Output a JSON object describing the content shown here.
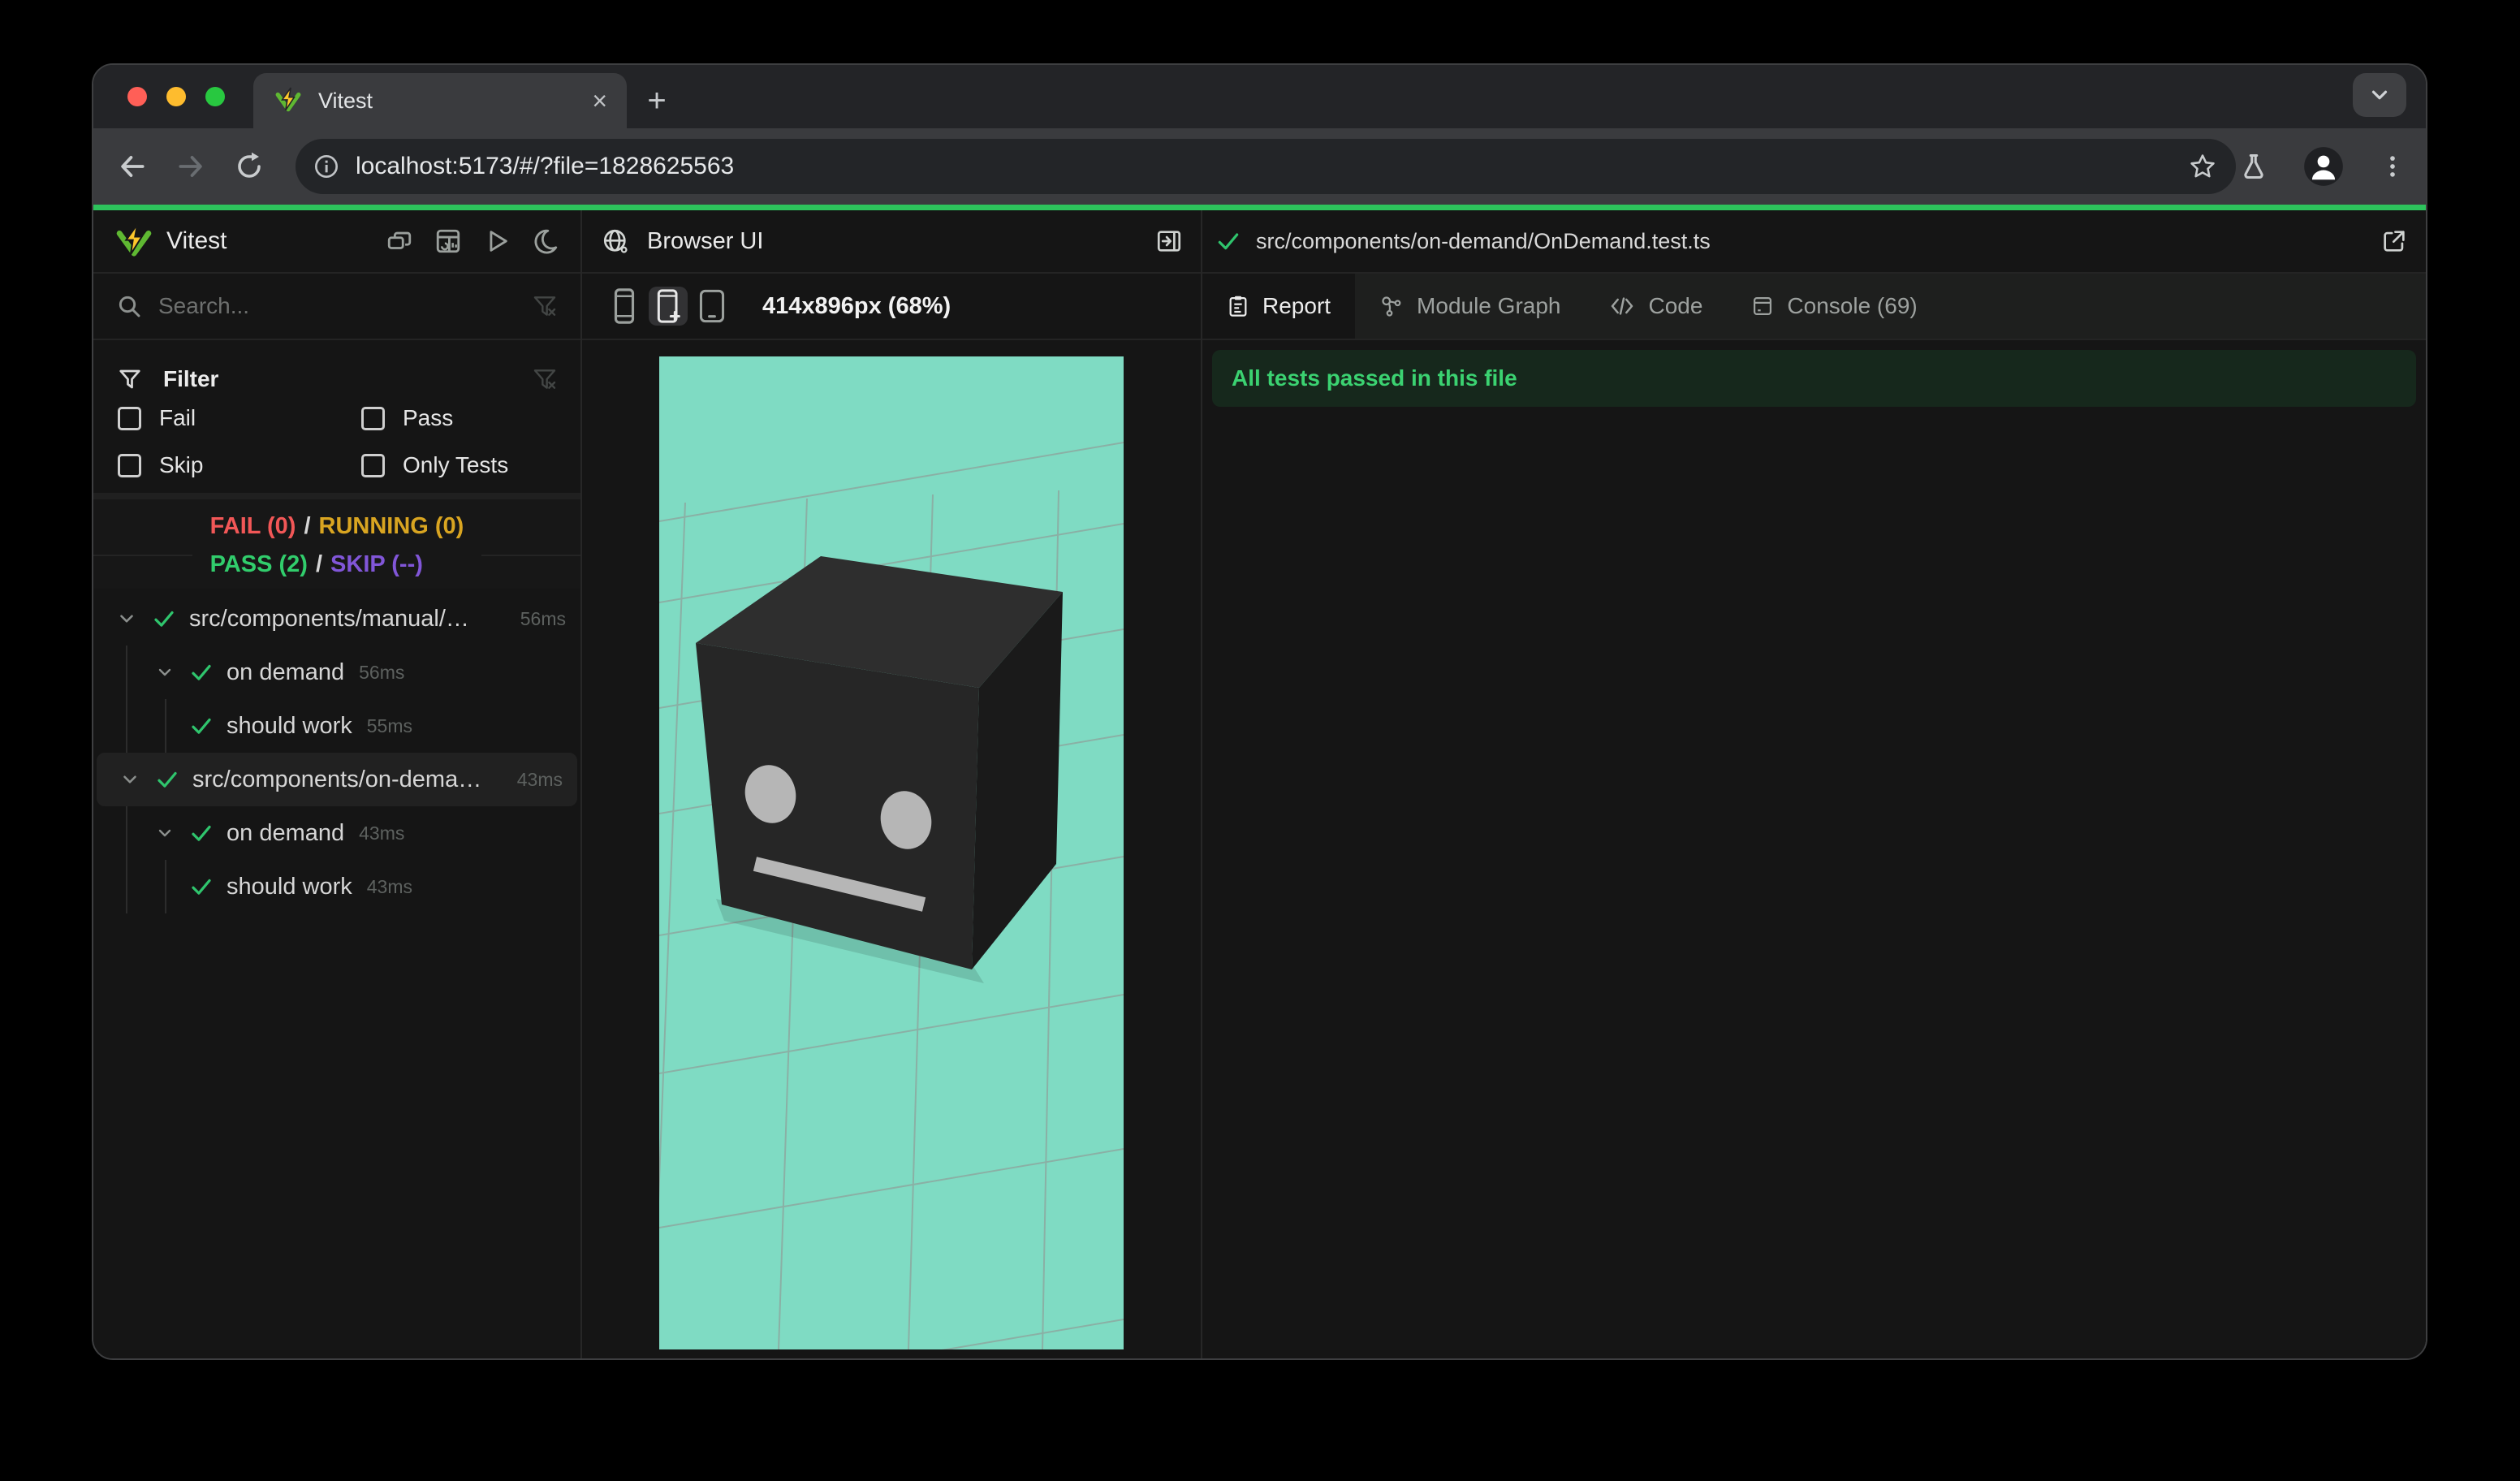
{
  "browser": {
    "tab_title": "Vitest",
    "url": "localhost:5173/#/?file=1828625563",
    "close_glyph": "×",
    "newtab_glyph": "+"
  },
  "sidebar": {
    "app_name": "Vitest",
    "search_placeholder": "Search...",
    "filter": {
      "title": "Filter",
      "options": [
        {
          "label": "Fail",
          "checked": false
        },
        {
          "label": "Pass",
          "checked": false
        },
        {
          "label": "Skip",
          "checked": false
        },
        {
          "label": "Only Tests",
          "checked": false
        }
      ]
    },
    "summary": {
      "fail": "FAIL (0)",
      "running": "RUNNING (0)",
      "pass": "PASS (2)",
      "skip": "SKIP (--)",
      "sep": "/"
    },
    "tree": [
      {
        "level": 1,
        "label": "src/components/manual/…",
        "time": "56ms",
        "status": "pass",
        "selected": false
      },
      {
        "level": 2,
        "label": "on demand",
        "time": "56ms",
        "status": "pass"
      },
      {
        "level": 3,
        "label": "should work",
        "time": "55ms",
        "status": "pass"
      },
      {
        "level": 1,
        "label": "src/components/on-dema…",
        "time": "43ms",
        "status": "pass",
        "selected": true
      },
      {
        "level": 2,
        "label": "on demand",
        "time": "43ms",
        "status": "pass"
      },
      {
        "level": 3,
        "label": "should work",
        "time": "43ms",
        "status": "pass"
      }
    ]
  },
  "preview": {
    "title": "Browser UI",
    "viewport": "414x896px (68%)"
  },
  "detail": {
    "file_path": "src/components/on-demand/OnDemand.test.ts",
    "tabs": [
      {
        "label": "Report",
        "active": true
      },
      {
        "label": "Module Graph",
        "active": false
      },
      {
        "label": "Code",
        "active": false
      },
      {
        "label": "Console (69)",
        "active": false
      }
    ],
    "banner": "All tests passed in this file"
  },
  "colors": {
    "accent_green": "#2dc35c",
    "pass_green": "#31cd6c",
    "fail_red": "#f25757",
    "running_yellow": "#d9a521",
    "skip_purple": "#8156d8",
    "canvas_teal": "#7fdbc3",
    "banner_bg": "#16281c",
    "traffic_red": "#ff5f57",
    "traffic_yellow": "#febc2e",
    "traffic_green": "#28c840"
  }
}
